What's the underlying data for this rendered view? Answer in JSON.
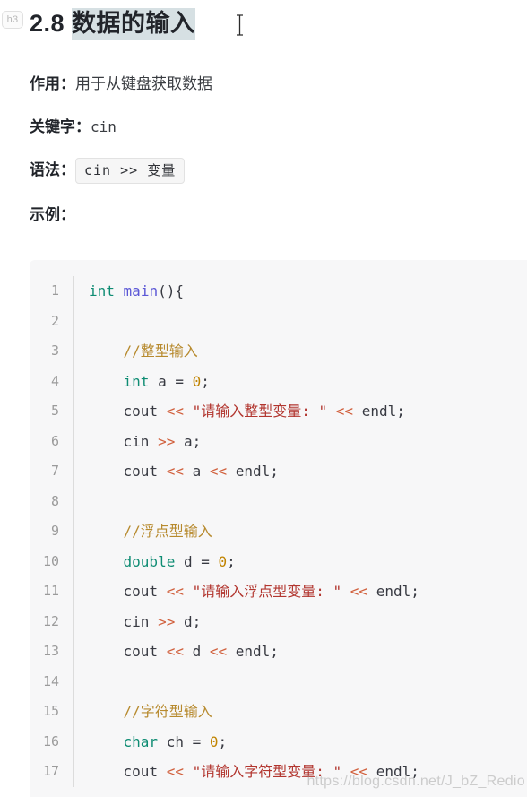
{
  "heading": {
    "badge": "h3",
    "number": "2.8 ",
    "selected_text": "数据的输入",
    "selection_color": "#d6e0e3",
    "caret_icon": "text-cursor-icon"
  },
  "paragraphs": [
    {
      "label": "作用：",
      "value": "用于从键盘获取数据",
      "value_style": "plain"
    },
    {
      "label": "关键字：",
      "value": "cin",
      "value_style": "mono"
    },
    {
      "label": "语法：",
      "value": "cin >> 变量",
      "value_style": "inline-code"
    },
    {
      "label": "示例：",
      "value": "",
      "value_style": "plain"
    }
  ],
  "code_block": {
    "language": "cpp",
    "background": "#f7f7f8",
    "gutter_color": "#9b9b9b",
    "lines": [
      {
        "n": "1",
        "tokens": [
          {
            "t": "int",
            "c": "t-kw"
          },
          {
            "t": " ",
            "c": "t-pln"
          },
          {
            "t": "main",
            "c": "t-fn"
          },
          {
            "t": "(){",
            "c": "t-pln"
          }
        ]
      },
      {
        "n": "2",
        "tokens": []
      },
      {
        "n": "3",
        "tokens": [
          {
            "t": "    ",
            "c": "t-pln"
          },
          {
            "t": "//整型输入",
            "c": "t-cmt"
          }
        ]
      },
      {
        "n": "4",
        "tokens": [
          {
            "t": "    ",
            "c": "t-pln"
          },
          {
            "t": "int",
            "c": "t-kw"
          },
          {
            "t": " a = ",
            "c": "t-pln"
          },
          {
            "t": "0",
            "c": "t-num"
          },
          {
            "t": ";",
            "c": "t-pln"
          }
        ]
      },
      {
        "n": "5",
        "tokens": [
          {
            "t": "    cout ",
            "c": "t-pln"
          },
          {
            "t": "<<",
            "c": "t-op"
          },
          {
            "t": " ",
            "c": "t-pln"
          },
          {
            "t": "\"请输入整型变量: \"",
            "c": "t-str"
          },
          {
            "t": " ",
            "c": "t-pln"
          },
          {
            "t": "<<",
            "c": "t-op"
          },
          {
            "t": " endl;",
            "c": "t-pln"
          }
        ]
      },
      {
        "n": "6",
        "tokens": [
          {
            "t": "    cin ",
            "c": "t-pln"
          },
          {
            "t": ">>",
            "c": "t-op"
          },
          {
            "t": " a;",
            "c": "t-pln"
          }
        ]
      },
      {
        "n": "7",
        "tokens": [
          {
            "t": "    cout ",
            "c": "t-pln"
          },
          {
            "t": "<<",
            "c": "t-op"
          },
          {
            "t": " a ",
            "c": "t-pln"
          },
          {
            "t": "<<",
            "c": "t-op"
          },
          {
            "t": " endl;",
            "c": "t-pln"
          }
        ]
      },
      {
        "n": "8",
        "tokens": []
      },
      {
        "n": "9",
        "tokens": [
          {
            "t": "    ",
            "c": "t-pln"
          },
          {
            "t": "//浮点型输入",
            "c": "t-cmt"
          }
        ]
      },
      {
        "n": "10",
        "tokens": [
          {
            "t": "    ",
            "c": "t-pln"
          },
          {
            "t": "double",
            "c": "t-kw"
          },
          {
            "t": " d = ",
            "c": "t-pln"
          },
          {
            "t": "0",
            "c": "t-num"
          },
          {
            "t": ";",
            "c": "t-pln"
          }
        ]
      },
      {
        "n": "11",
        "tokens": [
          {
            "t": "    cout ",
            "c": "t-pln"
          },
          {
            "t": "<<",
            "c": "t-op"
          },
          {
            "t": " ",
            "c": "t-pln"
          },
          {
            "t": "\"请输入浮点型变量: \"",
            "c": "t-str"
          },
          {
            "t": " ",
            "c": "t-pln"
          },
          {
            "t": "<<",
            "c": "t-op"
          },
          {
            "t": " endl;",
            "c": "t-pln"
          }
        ]
      },
      {
        "n": "12",
        "tokens": [
          {
            "t": "    cin ",
            "c": "t-pln"
          },
          {
            "t": ">>",
            "c": "t-op"
          },
          {
            "t": " d;",
            "c": "t-pln"
          }
        ]
      },
      {
        "n": "13",
        "tokens": [
          {
            "t": "    cout ",
            "c": "t-pln"
          },
          {
            "t": "<<",
            "c": "t-op"
          },
          {
            "t": " d ",
            "c": "t-pln"
          },
          {
            "t": "<<",
            "c": "t-op"
          },
          {
            "t": " endl;",
            "c": "t-pln"
          }
        ]
      },
      {
        "n": "14",
        "tokens": []
      },
      {
        "n": "15",
        "tokens": [
          {
            "t": "    ",
            "c": "t-pln"
          },
          {
            "t": "//字符型输入",
            "c": "t-cmt"
          }
        ]
      },
      {
        "n": "16",
        "tokens": [
          {
            "t": "    ",
            "c": "t-pln"
          },
          {
            "t": "char",
            "c": "t-kw"
          },
          {
            "t": " ch = ",
            "c": "t-pln"
          },
          {
            "t": "0",
            "c": "t-num"
          },
          {
            "t": ";",
            "c": "t-pln"
          }
        ]
      },
      {
        "n": "17",
        "tokens": [
          {
            "t": "    cout ",
            "c": "t-pln"
          },
          {
            "t": "<<",
            "c": "t-op"
          },
          {
            "t": " ",
            "c": "t-pln"
          },
          {
            "t": "\"请输入字符型变量: \"",
            "c": "t-str"
          },
          {
            "t": " ",
            "c": "t-pln"
          },
          {
            "t": "<<",
            "c": "t-op"
          },
          {
            "t": " endl;",
            "c": "t-pln"
          }
        ]
      }
    ]
  },
  "watermark": "https://blog.csdn.net/J_bZ_Redio"
}
